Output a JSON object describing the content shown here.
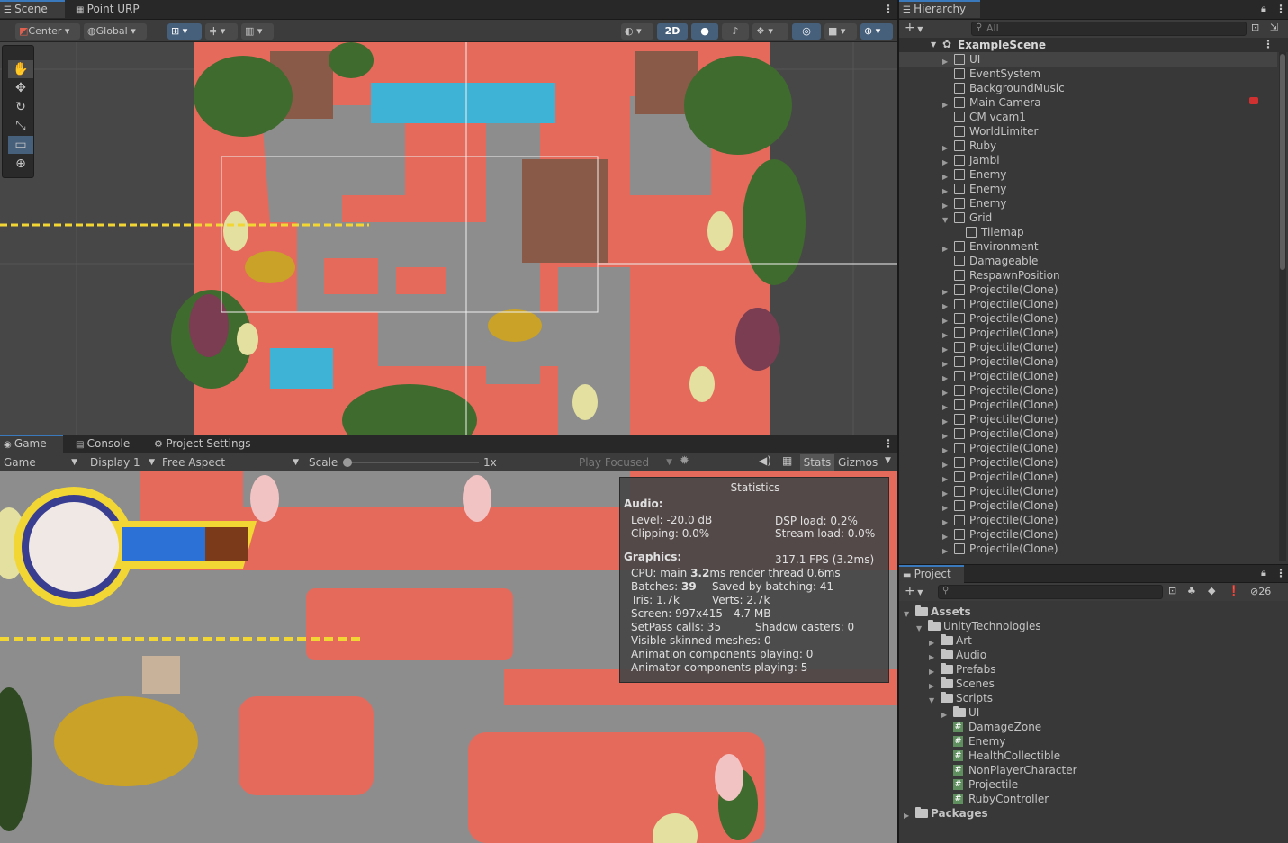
{
  "scene": {
    "tabs": [
      "Scene",
      "Point URP"
    ],
    "toolbar": {
      "pivot": "Center",
      "space": "Global",
      "mode2d": "2D"
    }
  },
  "game": {
    "tabs": [
      "Game",
      "Console",
      "Project Settings"
    ],
    "toolbar": {
      "view": "Game",
      "display": "Display 1",
      "aspect": "Free Aspect",
      "scale_label": "Scale",
      "scale_value": "1x",
      "play_mode": "Play Focused",
      "stats": "Stats",
      "gizmos": "Gizmos"
    },
    "health_fraction": 0.66,
    "statistics": {
      "title": "Statistics",
      "audio_header": "Audio:",
      "level": "Level: -20.0 dB",
      "dsp": "DSP load: 0.2%",
      "clipping": "Clipping: 0.0%",
      "stream": "Stream load: 0.0%",
      "graphics_header": "Graphics:",
      "fps": "317.1 FPS (3.2ms)",
      "cpu_label": "CPU: main ",
      "cpu_main": "3.2",
      "cpu_rest": "ms  render thread 0.6ms",
      "batches_label": "Batches: ",
      "batches": "39",
      "saved": "Saved by batching: 41",
      "tris": "Tris: 1.7k",
      "verts": "Verts: 2.7k",
      "screen": "Screen: 997x415 - 4.7 MB",
      "setpass": "SetPass calls: 35",
      "shadow": "Shadow casters: 0",
      "skinned": "Visible skinned meshes: 0",
      "animation": "Animation components playing: 0",
      "animator": "Animator components playing: 5"
    }
  },
  "hierarchy": {
    "title": "Hierarchy",
    "search_placeholder": "All",
    "scene_name": "ExampleScene",
    "items": [
      {
        "label": "UI",
        "arrow": true,
        "indent": 0
      },
      {
        "label": "EventSystem",
        "arrow": false,
        "indent": 0
      },
      {
        "label": "BackgroundMusic",
        "arrow": false,
        "indent": 0
      },
      {
        "label": "Main Camera",
        "arrow": true,
        "indent": 0
      },
      {
        "label": "CM vcam1",
        "arrow": false,
        "indent": 0
      },
      {
        "label": "WorldLimiter",
        "arrow": false,
        "indent": 0
      },
      {
        "label": "Ruby",
        "arrow": true,
        "indent": 0
      },
      {
        "label": "Jambi",
        "arrow": true,
        "indent": 0
      },
      {
        "label": "Enemy",
        "arrow": true,
        "indent": 0
      },
      {
        "label": "Enemy",
        "arrow": true,
        "indent": 0
      },
      {
        "label": "Enemy",
        "arrow": true,
        "indent": 0
      },
      {
        "label": "Grid",
        "arrow": true,
        "open": true,
        "indent": 0
      },
      {
        "label": "Tilemap",
        "arrow": false,
        "indent": 1
      },
      {
        "label": "Environment",
        "arrow": true,
        "indent": 0
      },
      {
        "label": "Damageable",
        "arrow": false,
        "indent": 0
      },
      {
        "label": "RespawnPosition",
        "arrow": false,
        "indent": 0
      },
      {
        "label": "Projectile(Clone)",
        "arrow": true,
        "indent": 0
      },
      {
        "label": "Projectile(Clone)",
        "arrow": true,
        "indent": 0
      },
      {
        "label": "Projectile(Clone)",
        "arrow": true,
        "indent": 0
      },
      {
        "label": "Projectile(Clone)",
        "arrow": true,
        "indent": 0
      },
      {
        "label": "Projectile(Clone)",
        "arrow": true,
        "indent": 0
      },
      {
        "label": "Projectile(Clone)",
        "arrow": true,
        "indent": 0
      },
      {
        "label": "Projectile(Clone)",
        "arrow": true,
        "indent": 0
      },
      {
        "label": "Projectile(Clone)",
        "arrow": true,
        "indent": 0
      },
      {
        "label": "Projectile(Clone)",
        "arrow": true,
        "indent": 0
      },
      {
        "label": "Projectile(Clone)",
        "arrow": true,
        "indent": 0
      },
      {
        "label": "Projectile(Clone)",
        "arrow": true,
        "indent": 0
      },
      {
        "label": "Projectile(Clone)",
        "arrow": true,
        "indent": 0
      },
      {
        "label": "Projectile(Clone)",
        "arrow": true,
        "indent": 0
      },
      {
        "label": "Projectile(Clone)",
        "arrow": true,
        "indent": 0
      },
      {
        "label": "Projectile(Clone)",
        "arrow": true,
        "indent": 0
      },
      {
        "label": "Projectile(Clone)",
        "arrow": true,
        "indent": 0
      },
      {
        "label": "Projectile(Clone)",
        "arrow": true,
        "indent": 0
      },
      {
        "label": "Projectile(Clone)",
        "arrow": true,
        "indent": 0
      },
      {
        "label": "Projectile(Clone)",
        "arrow": true,
        "indent": 0
      }
    ]
  },
  "project": {
    "title": "Project",
    "hidden_count": "26",
    "tree": [
      {
        "label": "Assets",
        "type": "folder",
        "indent": 0,
        "arrow": "open",
        "bold": true
      },
      {
        "label": "UnityTechnologies",
        "type": "folder",
        "indent": 1,
        "arrow": "open"
      },
      {
        "label": "Art",
        "type": "folder",
        "indent": 2,
        "arrow": "closed"
      },
      {
        "label": "Audio",
        "type": "folder",
        "indent": 2,
        "arrow": "closed"
      },
      {
        "label": "Prefabs",
        "type": "folder",
        "indent": 2,
        "arrow": "closed"
      },
      {
        "label": "Scenes",
        "type": "folder",
        "indent": 2,
        "arrow": "closed"
      },
      {
        "label": "Scripts",
        "type": "folder",
        "indent": 2,
        "arrow": "open"
      },
      {
        "label": "UI",
        "type": "folder",
        "indent": 3,
        "arrow": "closed"
      },
      {
        "label": "DamageZone",
        "type": "script",
        "indent": 3,
        "arrow": "none"
      },
      {
        "label": "Enemy",
        "type": "script",
        "indent": 3,
        "arrow": "none"
      },
      {
        "label": "HealthCollectible",
        "type": "script",
        "indent": 3,
        "arrow": "none"
      },
      {
        "label": "NonPlayerCharacter",
        "type": "script",
        "indent": 3,
        "arrow": "none"
      },
      {
        "label": "Projectile",
        "type": "script",
        "indent": 3,
        "arrow": "none"
      },
      {
        "label": "RubyController",
        "type": "script",
        "indent": 3,
        "arrow": "none"
      },
      {
        "label": "Packages",
        "type": "folder",
        "indent": 0,
        "arrow": "closed",
        "bold": true
      }
    ]
  },
  "colors": {
    "accent": "#3a79bb",
    "ground": "#e56a5c",
    "stone": "#8a8a8a",
    "water": "#3fb3d6",
    "foliage": "#3f6b2e"
  }
}
